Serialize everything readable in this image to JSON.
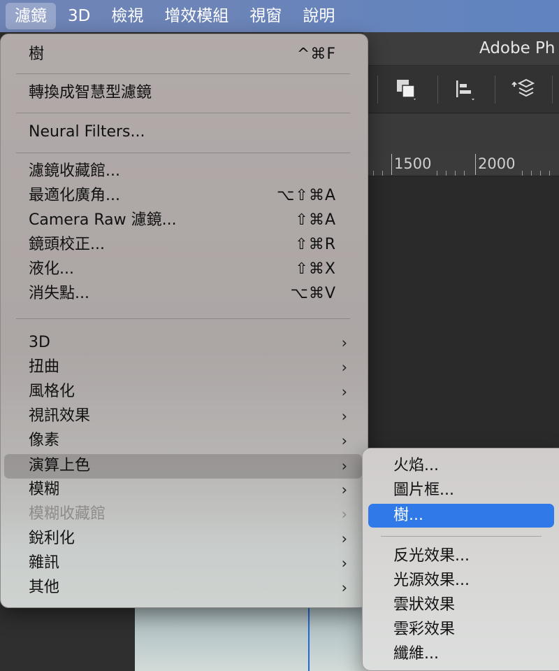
{
  "menubar": {
    "items": [
      {
        "label": "濾鏡"
      },
      {
        "label": "3D"
      },
      {
        "label": "檢視"
      },
      {
        "label": "增效模組"
      },
      {
        "label": "視窗"
      },
      {
        "label": "說明"
      }
    ]
  },
  "app": {
    "title": "Adobe Ph",
    "ruler": {
      "labels": [
        "1500",
        "2000"
      ]
    }
  },
  "filter_menu": {
    "last_filter": {
      "label": "樹",
      "shortcut": "^⌘F"
    },
    "convert_smart": {
      "label": "轉換成智慧型濾鏡"
    },
    "neural": {
      "label": "Neural Filters..."
    },
    "items": [
      {
        "label": "濾鏡收藏館...",
        "shortcut": ""
      },
      {
        "label": "最適化廣角...",
        "shortcut": "⌥⇧⌘A"
      },
      {
        "label": "Camera Raw 濾鏡...",
        "shortcut": "⇧⌘A"
      },
      {
        "label": "鏡頭校正...",
        "shortcut": "⇧⌘R"
      },
      {
        "label": "液化...",
        "shortcut": "⇧⌘X"
      },
      {
        "label": "消失點...",
        "shortcut": "⌥⌘V"
      }
    ],
    "submenus": [
      {
        "label": "3D",
        "arrow": "›"
      },
      {
        "label": "扭曲",
        "arrow": "›"
      },
      {
        "label": "風格化",
        "arrow": "›"
      },
      {
        "label": "視訊效果",
        "arrow": "›"
      },
      {
        "label": "像素",
        "arrow": "›"
      },
      {
        "label": "演算上色",
        "arrow": "›"
      },
      {
        "label": "模糊",
        "arrow": "›"
      },
      {
        "label": "模糊收藏館",
        "arrow": "›"
      },
      {
        "label": "銳利化",
        "arrow": "›"
      },
      {
        "label": "雜訊",
        "arrow": "›"
      },
      {
        "label": "其他",
        "arrow": "›"
      }
    ]
  },
  "render_submenu": {
    "items_top": [
      {
        "label": "火焰..."
      },
      {
        "label": "圖片框..."
      },
      {
        "label": "樹..."
      }
    ],
    "items_bottom": [
      {
        "label": "反光效果..."
      },
      {
        "label": "光源效果..."
      },
      {
        "label": "雲狀效果"
      },
      {
        "label": "雲彩效果"
      },
      {
        "label": "纖維..."
      }
    ],
    "selected_color": "#2f79e8"
  }
}
